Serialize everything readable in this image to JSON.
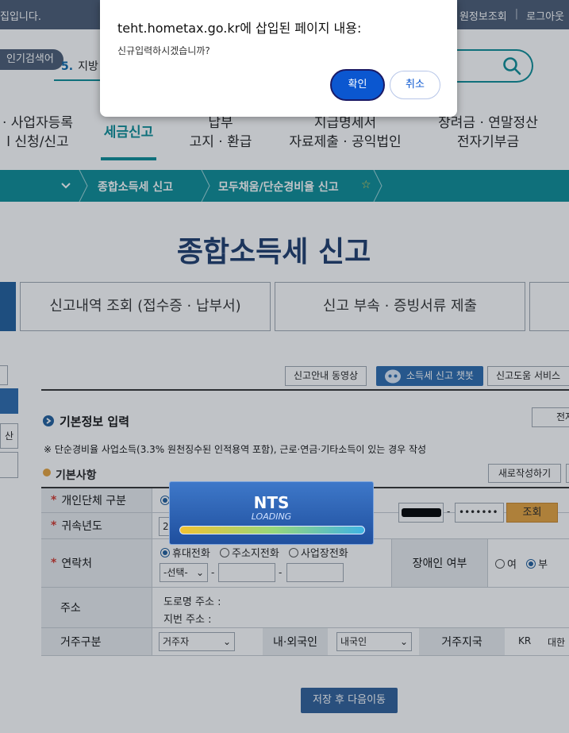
{
  "topbar": {
    "left_text": "집입니다.",
    "right_items": [
      "원정보조회",
      "|",
      "로그아웃"
    ]
  },
  "search": {
    "trend_label": "인기검색어",
    "trend_rank": "5.",
    "trend_text": "지방"
  },
  "nav": {
    "items": [
      {
        "line1": "· 사업자등록",
        "line2": "l 신청/신고"
      },
      {
        "line1": "세금신고",
        "line2": ""
      },
      {
        "line1": "납부",
        "line2": "고지 · 환급"
      },
      {
        "line1": "지급명세서",
        "line2": "자료제출 · 공익법인"
      },
      {
        "line1": "장려금 · 연말정산",
        "line2": "전자기부금"
      }
    ]
  },
  "breadcrumb": {
    "item1": "종합소득세 신고",
    "item2": "모두채움/단순경비율 신고",
    "star": "☆"
  },
  "page": {
    "title": "종합소득세 신고",
    "tabs": [
      "신고내역 조회 (접수증 · 납부서)",
      "신고 부속 · 증빙서류 제출"
    ],
    "side_label": "산"
  },
  "toolbar": {
    "video": "신고안내 동영상",
    "chatbot": "소득세 신고 챗봇",
    "help": "신고도움 서비스"
  },
  "form": {
    "section_title": "기본정보 입력",
    "right_btn": "전자",
    "note": "※ 단순경비율 사업소득(3.3% 원천징수된 인적용역 포함), 근로·연금·기타소득이 있는 경우 작성",
    "sub_title": "기본사항",
    "new_btn": "새로작성하기",
    "rows": {
      "individual": "개인단체 구분",
      "year": "귀속년도",
      "year_value": "2",
      "contact": "연락처",
      "address": "주소",
      "residence": "거주구분"
    },
    "ssn_masked": "•••••••",
    "lookup": "조회",
    "phone_radios": [
      "휴대전화",
      "주소지전화",
      "사업장전화"
    ],
    "phone_select": "-선택-",
    "dash": "-",
    "disability_label": "장애인 여부",
    "disability_yes": "여",
    "disability_no": "부",
    "road_address": "도로명 주소 :",
    "lot_address": "지번 주소 :",
    "residence_value": "거주자",
    "nationality_label": "내·외국인",
    "nationality_value": "내국인",
    "country_label": "거주지국",
    "country_code": "KR",
    "country_name": "대한",
    "save": "저장 후 다음이동"
  },
  "loading": {
    "brand": "NTS",
    "text": "LOADING"
  },
  "dialog": {
    "title": "teht.hometax.go.kr에 삽입된 페이지 내용:",
    "message": "신규입력하시겠습니까?",
    "ok": "확인",
    "cancel": "취소"
  },
  "colors": {
    "teal": "#0a8d96",
    "navy": "#1c3b6b",
    "blue": "#0b57d0",
    "orange": "#e6a23c"
  }
}
